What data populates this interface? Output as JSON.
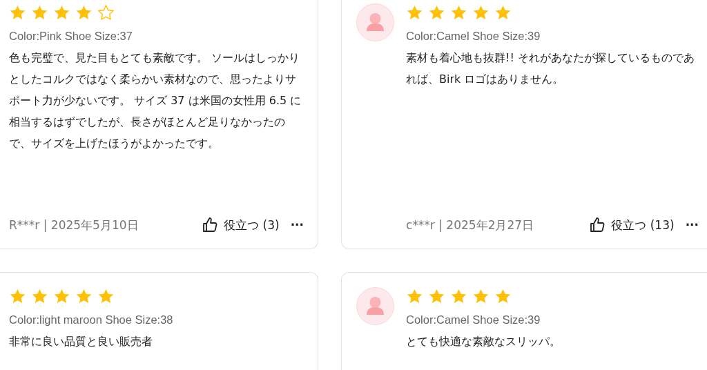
{
  "reviews": [
    {
      "avatar": false,
      "stars": 4,
      "variant": "Color:Pink Shoe Size:37",
      "text": "色も完璧で、見た目もとても素敵です。 ソールはしっかりとしたコルクではなく柔らかい素材なので、思ったよりサポート力が少ないです。 サイズ 37 は米国の女性用 6.5 に相当するはずでしたが、長さがほとんど足りなかったので、サイズを上げたほうがよかったです。",
      "author_date": "R***r | 2025年5月10日",
      "helpful": "役立つ (3)",
      "more": "···"
    },
    {
      "avatar": true,
      "stars": 5,
      "variant": "Color:Camel Shoe Size:39",
      "text": "素材も着心地も抜群!! それがあなたが探しているものであれば、Birk ロゴはありません。",
      "author_date": "c***r | 2025年2月27日",
      "helpful": "役立つ (13)",
      "more": "···"
    },
    {
      "avatar": false,
      "stars": 5,
      "variant": "Color:light maroon Shoe Size:38",
      "text": "非常に良い品質と良い販売者"
    },
    {
      "avatar": true,
      "stars": 5,
      "variant": "Color:Camel Shoe Size:39",
      "text": "とても快適な素敵なスリッパ。"
    }
  ]
}
